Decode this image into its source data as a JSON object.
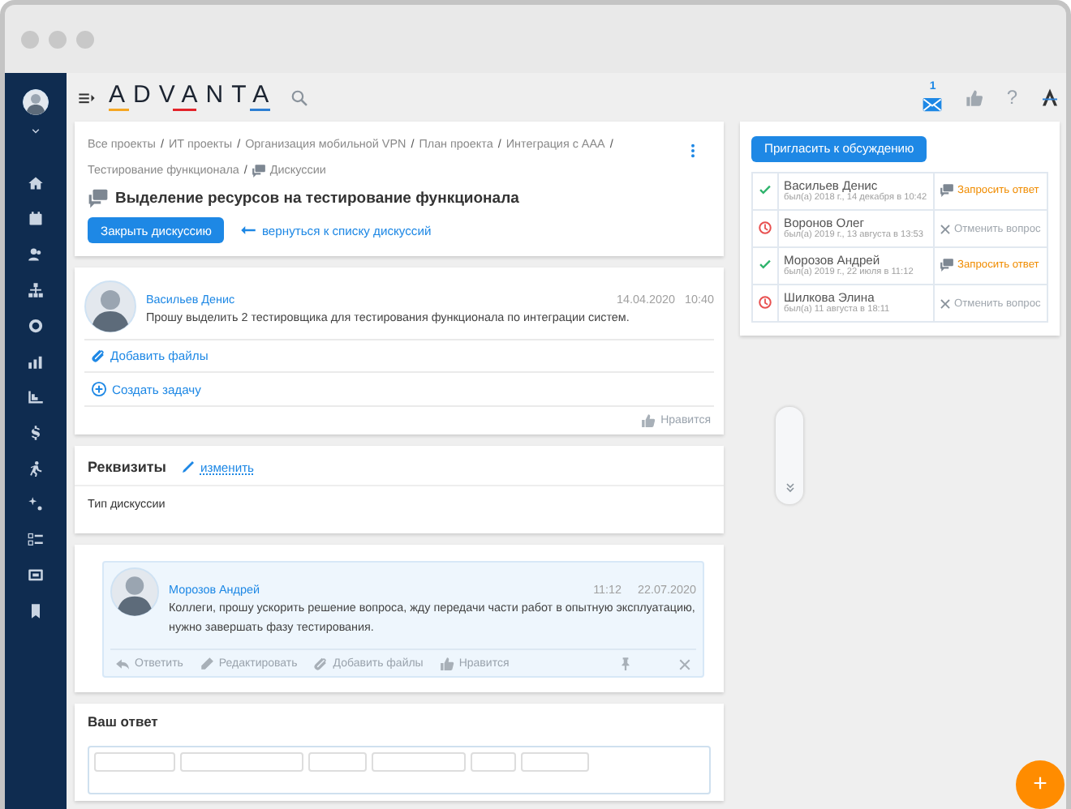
{
  "header": {
    "logo": "ADVANTA",
    "notifications_badge": "1",
    "help": "?"
  },
  "discussion": {
    "breadcrumbs": [
      {
        "label": "Все проекты",
        "kind": "page"
      },
      {
        "label": "ИТ проекты",
        "kind": "page"
      },
      {
        "label": "Организация мобильной VPN",
        "kind": "page"
      },
      {
        "label": "План проекта",
        "kind": "page"
      },
      {
        "label": "Интеграция с ААА",
        "kind": "page"
      },
      {
        "label": "Тестирование функционала",
        "kind": "page"
      },
      {
        "label": "Дискуссии",
        "kind": "discussions"
      }
    ],
    "separator": "/",
    "title": "Выделение ресурсов на тестирование функционала",
    "close_button": "Закрыть дискуссию",
    "back_link": "вернуться к списку дискуссий"
  },
  "participants": {
    "invite_button": "Пригласить к обсуждению",
    "rows": [
      {
        "name": "Васильев Денис",
        "seen": "был(а) 2018 г., 14 декабря в 10:42",
        "kind": "answered",
        "action": {
          "kind": "request",
          "label": "Запросить ответ"
        }
      },
      {
        "name": "Воронов Олег",
        "seen": "был(а) 2019 г., 13 августа в 13:53",
        "kind": "pending",
        "action": {
          "kind": "cancel",
          "label": "Отменить вопрос"
        }
      },
      {
        "name": "Морозов Андрей",
        "seen": "был(а) 2019 г., 22 июля в 11:12",
        "kind": "answered",
        "action": {
          "kind": "request",
          "label": "Запросить ответ"
        }
      },
      {
        "name": "Шилкова Элина",
        "seen": "был(а) 11 августа в 18:11",
        "kind": "pending",
        "action": {
          "kind": "cancel",
          "label": "Отменить вопрос"
        }
      }
    ]
  },
  "post": {
    "author": "Васильев Денис",
    "date": "14.04.2020",
    "time": "10:40",
    "text": "Прошу выделить 2 тестировщика для тестирования функционала по интеграции систем.",
    "add_files": "Добавить файлы",
    "create_task": "Создать задачу",
    "like": "Нравится"
  },
  "details": {
    "title": "Реквизиты",
    "edit_link": "изменить",
    "fields": [
      "Тип дискуссии"
    ]
  },
  "comment": {
    "author": "Морозов Андрей",
    "time": "11:12",
    "date": "22.07.2020",
    "text": "Коллеги, прошу ускорить решение вопроса, жду передачи части работ в опытную эксплуатацию, нужно завершать фазу тестирования.",
    "actions": [
      {
        "kind": "reply",
        "label": "Ответить"
      },
      {
        "kind": "edit",
        "label": "Редактировать"
      },
      {
        "kind": "attach",
        "label": "Добавить файлы"
      },
      {
        "kind": "like",
        "label": "Нравится"
      }
    ]
  },
  "reply": {
    "title": "Ваш ответ"
  },
  "fab": "+"
}
